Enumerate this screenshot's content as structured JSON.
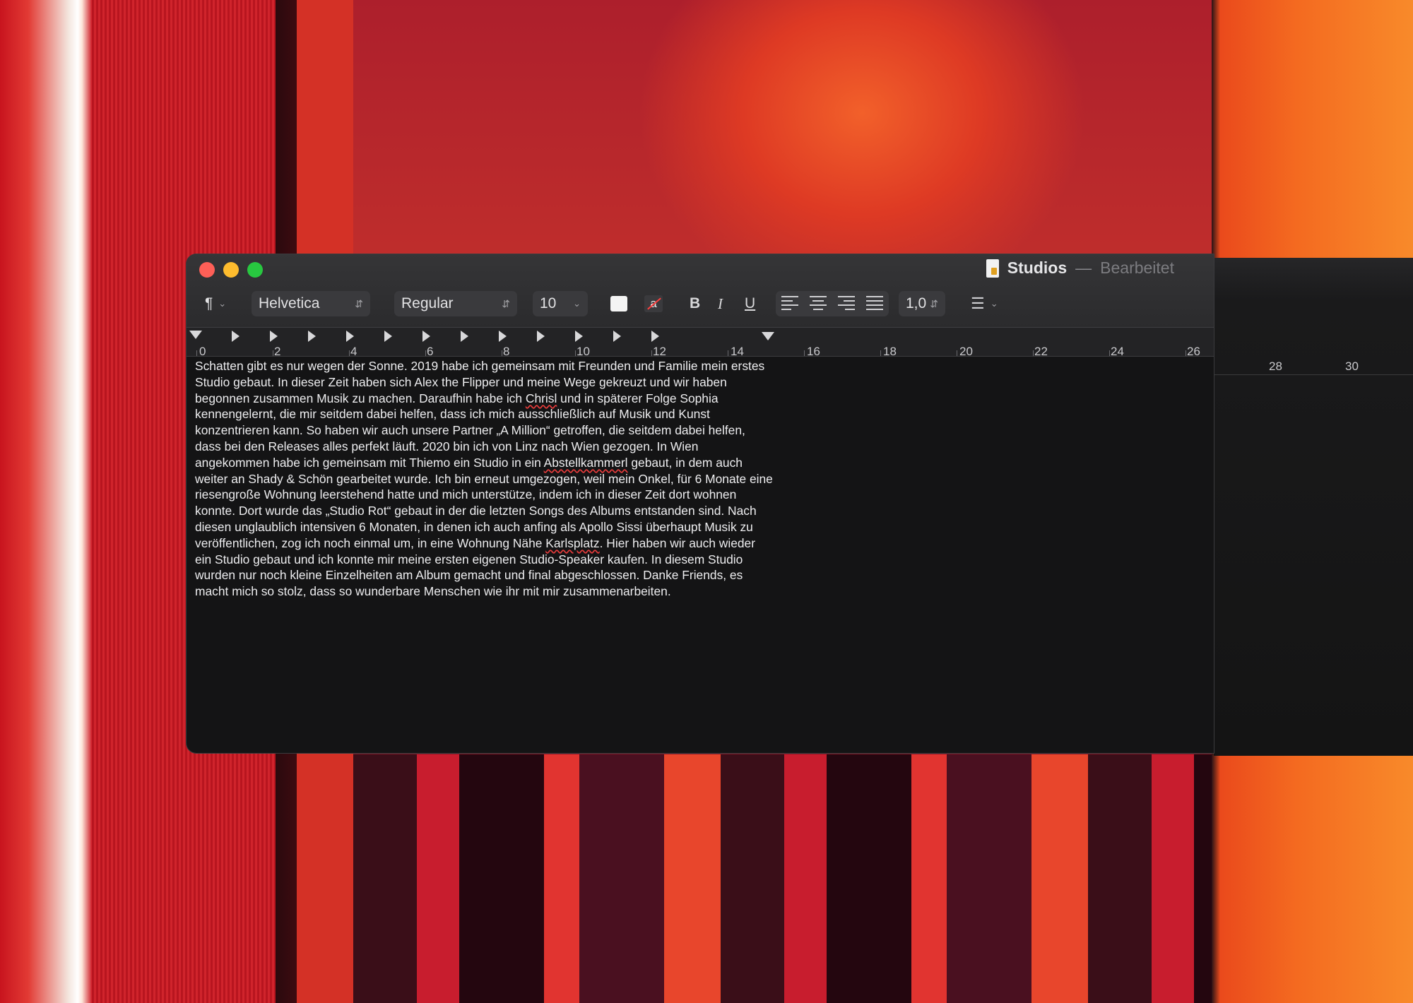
{
  "window": {
    "title": "Studios",
    "separator": "—",
    "status": "Bearbeitet"
  },
  "toolbar": {
    "paragraph_style": "¶",
    "font_family": "Helvetica",
    "font_style": "Regular",
    "font_size": "10",
    "bold": "B",
    "italic": "I",
    "underline": "U",
    "line_spacing": "1,0",
    "highlight_glyph": "a"
  },
  "ruler": {
    "numbers": [
      "0",
      "2",
      "4",
      "6",
      "8",
      "10",
      "12",
      "14",
      "16",
      "18",
      "20",
      "22",
      "24",
      "26",
      "28",
      "30"
    ]
  },
  "document": {
    "p1": "Schatten gibt es nur wegen der Sonne. 2019 habe ich gemeinsam mit Freunden und Familie mein erstes Studio gebaut. In dieser Zeit haben sich Alex the Flipper und meine Wege gekreuzt und wir haben begonnen zusammen Musik zu machen. Daraufhin habe ich ",
    "w_chrisi": "Chrisl",
    "p2": " und in späterer Folge Sophia kennengelernt, die mir seitdem dabei helfen, dass ich mich ausschließlich auf Musik und Kunst konzentrieren kann. So haben wir auch unsere Partner „A Million“ getroffen, die seitdem dabei helfen, dass bei den Releases alles perfekt läuft. 2020 bin ich von Linz nach Wien gezogen. In Wien angekommen habe ich gemeinsam mit Thiemo ein Studio in ein ",
    "w_abstell": "Abstellkammerl",
    "p3": " gebaut, in dem auch weiter an Shady & Schön gearbeitet wurde. Ich bin erneut umgezogen, weil mein Onkel, für 6 Monate eine riesengroße Wohnung leerstehend hatte und mich unterstütze, indem ich in dieser Zeit dort wohnen konnte. Dort wurde das „Studio Rot“ gebaut in der die letzten Songs des Albums entstanden sind. Nach diesen unglaublich intensiven 6 Monaten, in denen ich auch anfing als Apollo Sissi überhaupt Musik zu veröffentlichen, zog ich noch einmal um, in eine Wohnung Nähe ",
    "w_karls": "Karlsplatz",
    "p4": ". Hier haben wir auch wieder ein Studio gebaut und ich konnte mir meine ersten eigenen Studio-Speaker kaufen. In diesem Studio wurden nur noch kleine Einzelheiten am Album gemacht und final abgeschlossen. Danke Friends, es macht mich so stolz, dass so wunderbare Menschen wie ihr mit mir zusammenarbeiten."
  },
  "colors": {
    "close": "#fe5f57",
    "minimize": "#febc2e",
    "maximize": "#28c840",
    "spellcheck": "#e63b3b"
  },
  "icons": [
    "paragraph-style-icon",
    "chevron-down-icon",
    "updown-arrows-icon",
    "text-color-swatch",
    "highlight-color-icon",
    "align-left-icon",
    "align-center-icon",
    "align-right-icon",
    "justify-icon",
    "list-icon",
    "document-icon"
  ]
}
